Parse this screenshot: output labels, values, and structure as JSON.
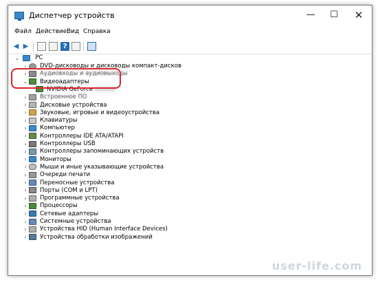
{
  "window": {
    "title": "Диспетчер устройств",
    "min": "—",
    "max": "☐",
    "close": "✕"
  },
  "menu": [
    "Файл",
    "Действие",
    "Вид",
    "Справка"
  ],
  "toolbar": {
    "icons": [
      "back-arrow-icon",
      "forward-arrow-icon",
      "properties-icon",
      "help-icon",
      "update-driver-icon",
      "monitor-icon"
    ]
  },
  "tree": {
    "root": "PC",
    "items": [
      {
        "label": "DVD-дисководы и дисководы компакт-дисков",
        "expanded": false,
        "icon": "dvd-icon"
      },
      {
        "label": "Аудиовходы и аудиовыходы",
        "expanded": false,
        "icon": "audio-icon",
        "obscured": true
      },
      {
        "label": "Видеоадаптеры",
        "expanded": true,
        "icon": "display-adapter-icon"
      },
      {
        "label": "NVIDIA GeForce",
        "child": true,
        "icon": "display-adapter-icon",
        "blurred_suffix": true
      },
      {
        "label": "Встроенное ПО",
        "expanded": false,
        "icon": "firmware-icon",
        "obscured": true
      },
      {
        "label": "Дисковые устройства",
        "expanded": false,
        "icon": "disk-icon"
      },
      {
        "label": "Звуковые, игровые и видеоустройства",
        "expanded": false,
        "icon": "sound-icon"
      },
      {
        "label": "Клавиатуры",
        "expanded": false,
        "icon": "keyboard-icon"
      },
      {
        "label": "Компьютер",
        "expanded": false,
        "icon": "computer-icon"
      },
      {
        "label": "Контроллеры IDE ATA/ATAPI",
        "expanded": false,
        "icon": "ide-controller-icon"
      },
      {
        "label": "Контроллеры USB",
        "expanded": false,
        "icon": "usb-icon"
      },
      {
        "label": "Контроллеры запоминающих устройств",
        "expanded": false,
        "icon": "storage-controller-icon"
      },
      {
        "label": "Мониторы",
        "expanded": false,
        "icon": "monitor-icon"
      },
      {
        "label": "Мыши и иные указывающие устройства",
        "expanded": false,
        "icon": "mouse-icon"
      },
      {
        "label": "Очереди печати",
        "expanded": false,
        "icon": "printer-icon"
      },
      {
        "label": "Переносные устройства",
        "expanded": false,
        "icon": "portable-device-icon"
      },
      {
        "label": "Порты (COM и LPT)",
        "expanded": false,
        "icon": "port-icon"
      },
      {
        "label": "Программные устройства",
        "expanded": false,
        "icon": "software-device-icon"
      },
      {
        "label": "Процессоры",
        "expanded": false,
        "icon": "processor-icon"
      },
      {
        "label": "Сетевые адаптеры",
        "expanded": false,
        "icon": "network-adapter-icon"
      },
      {
        "label": "Системные устройства",
        "expanded": false,
        "icon": "system-device-icon"
      },
      {
        "label": "Устройства HID (Human Interface Devices)",
        "expanded": false,
        "icon": "hid-icon"
      },
      {
        "label": "Устройства обработки изображений",
        "expanded": false,
        "icon": "imaging-device-icon"
      }
    ]
  },
  "watermark": "user-life.com",
  "colors": {
    "highlight": "#d7262b",
    "icon_blue": "#3a88c9",
    "icon_gray": "#8a8a8a",
    "icon_green": "#4f8a3c"
  }
}
